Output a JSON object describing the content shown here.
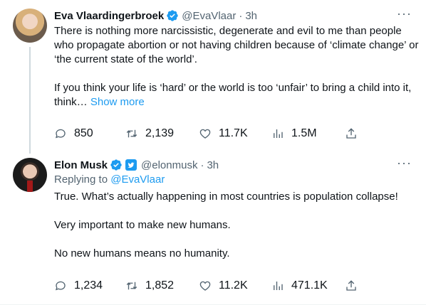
{
  "tweets": [
    {
      "name": "Eva Vlaardingerbroek",
      "handle": "@EvaVlaar",
      "time": "3h",
      "paragraphs": [
        "There is nothing more narcissistic, degenerate and evil to me than people who propagate abortion or not having children because of ‘climate change’ or ‘the current state of the world’.",
        "If you think your life is ‘hard’ or the world is too ‘unfair’ to bring a child into it, think…"
      ],
      "show_more": "Show more",
      "stats": {
        "replies": "850",
        "retweets": "2,139",
        "likes": "11.7K",
        "views": "1.5M"
      }
    },
    {
      "name": "Elon Musk",
      "handle": "@elonmusk",
      "time": "3h",
      "replying_prefix": "Replying to ",
      "replying_handle": "@EvaVlaar",
      "paragraphs": [
        "True. What’s actually happening in most countries is population collapse!",
        "Very important to make new humans.",
        "No new humans means no humanity."
      ],
      "stats": {
        "replies": "1,234",
        "retweets": "1,852",
        "likes": "11.2K",
        "views": "471.1K"
      }
    }
  ],
  "separator_dot": "·",
  "more_icon": "···",
  "colors": {
    "accent": "#1d9bf0",
    "muted": "#536471",
    "text": "#0f1419",
    "verified": "#1d9bf0"
  }
}
